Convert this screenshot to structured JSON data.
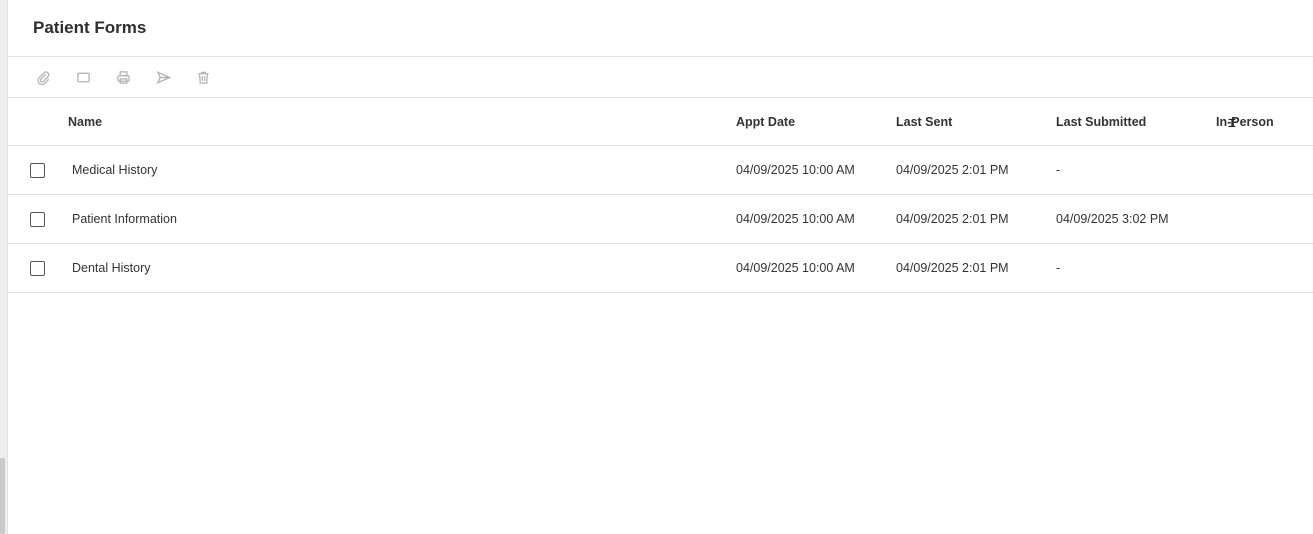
{
  "panel": {
    "title": "Patient Forms"
  },
  "toolbar": {
    "buttons": [
      {
        "name": "attach",
        "icon": "paperclip-icon"
      },
      {
        "name": "view",
        "icon": "rectangle-icon"
      },
      {
        "name": "print",
        "icon": "printer-icon"
      },
      {
        "name": "send",
        "icon": "send-icon"
      },
      {
        "name": "delete",
        "icon": "trash-icon"
      }
    ]
  },
  "table": {
    "columns": [
      "Name",
      "Appt Date",
      "Last Sent",
      "Last Submitted",
      "In-Person"
    ],
    "rows": [
      {
        "name": "Medical History",
        "appt_date": "04/09/2025 10:00 AM",
        "last_sent": "04/09/2025 2:01 PM",
        "last_submitted": "-",
        "in_person": ""
      },
      {
        "name": "Patient Information",
        "appt_date": "04/09/2025 10:00 AM",
        "last_sent": "04/09/2025 2:01 PM",
        "last_submitted": "04/09/2025 3:02 PM",
        "in_person": ""
      },
      {
        "name": "Dental History",
        "appt_date": "04/09/2025 10:00 AM",
        "last_sent": "04/09/2025 2:01 PM",
        "last_submitted": "-",
        "in_person": ""
      }
    ]
  },
  "colors": {
    "border": "#dedee0",
    "icon": "#b4b4b8",
    "text": "#333333"
  }
}
